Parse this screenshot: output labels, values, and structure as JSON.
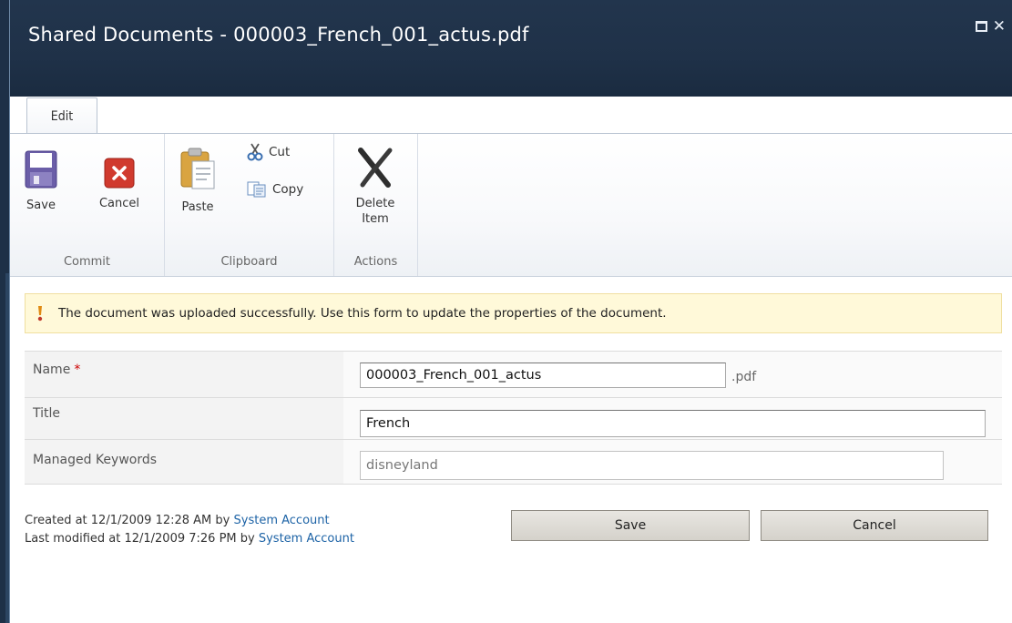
{
  "window": {
    "title": "Shared Documents - 000003_French_001_actus.pdf"
  },
  "ribbon": {
    "tab_label": "Edit",
    "commit": {
      "label": "Commit",
      "save_label": "Save",
      "cancel_label": "Cancel"
    },
    "clipboard": {
      "label": "Clipboard",
      "paste_label": "Paste",
      "cut_label": "Cut",
      "copy_label": "Copy"
    },
    "actions": {
      "label": "Actions",
      "delete_line1": "Delete",
      "delete_line2": "Item"
    }
  },
  "info": {
    "message": "The document was uploaded successfully. Use this form to update the properties of the document."
  },
  "form": {
    "name": {
      "label": "Name",
      "required_marker": "*",
      "value": "000003_French_001_actus",
      "suffix": ".pdf"
    },
    "title": {
      "label": "Title",
      "value": "French"
    },
    "keywords": {
      "label": "Managed Keywords",
      "value": "disneyland"
    }
  },
  "footer": {
    "created_prefix": "Created at 12/1/2009 12:28 AM by",
    "created_by": "System Account",
    "modified_prefix": "Last modified at 12/1/2009 7:26 PM by",
    "modified_by": "System Account",
    "save_label": "Save",
    "cancel_label": "Cancel"
  },
  "colors": {
    "titlebar": "#1f3148",
    "link": "#1d63a6",
    "infobar": "#fff9d9",
    "required": "#cc0000"
  }
}
